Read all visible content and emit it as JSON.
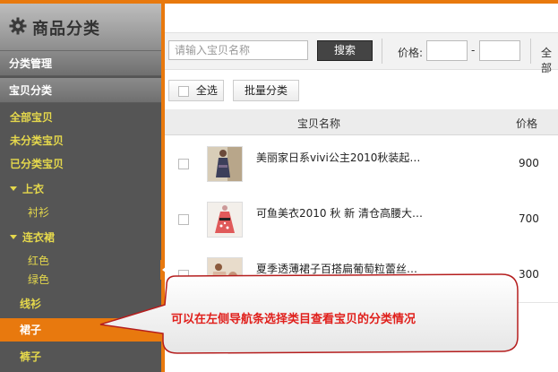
{
  "sidebar": {
    "title": "商品分类",
    "sections": [
      "分类管理",
      "宝贝分类"
    ],
    "items": [
      {
        "label": "全部宝贝"
      },
      {
        "label": "未分类宝贝"
      },
      {
        "label": "已分类宝贝"
      },
      {
        "label": "上衣"
      },
      {
        "label": "衬衫"
      },
      {
        "label": "连衣裙"
      },
      {
        "label": "红色"
      },
      {
        "label": "绿色"
      },
      {
        "label": "线衫"
      },
      {
        "label": "裙子"
      },
      {
        "label": "裤子"
      }
    ]
  },
  "search": {
    "placeholder": "请输入宝贝名称",
    "button_label": "搜索",
    "price_label": "价格:",
    "price_dash": "-",
    "all_label": "全部"
  },
  "actions": {
    "select_all": "全选",
    "batch_categorize": "批量分类"
  },
  "table": {
    "headers": {
      "name": "宝贝名称",
      "price": "价格"
    },
    "rows": [
      {
        "title": "美丽家日系vivi公主2010秋装起…",
        "price": "900"
      },
      {
        "title": "可鱼美衣2010 秋 新 清仓高腰大…",
        "price": "700"
      },
      {
        "title": "夏季透薄裙子百搭扁葡萄粒蕾丝…",
        "price": "300"
      }
    ]
  },
  "callout": {
    "text": "可以在左侧导航条选择类目查看宝贝的分类情况"
  },
  "colors": {
    "accent": "#e8790e",
    "sidebar_bg": "#555555",
    "sidebar_text": "#e5d84c",
    "callout_text": "#e0201c"
  }
}
